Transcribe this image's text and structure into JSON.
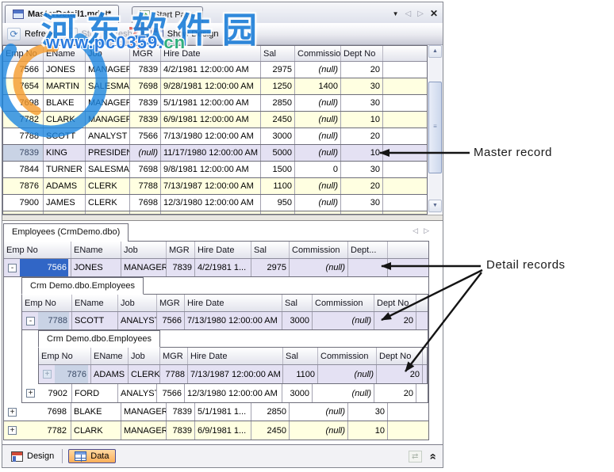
{
  "window": {
    "document_tabs": [
      {
        "label": "MasterDetail1.mdet*",
        "active": true
      },
      {
        "label": "Start Page",
        "active": false
      }
    ],
    "controls": {
      "dropdown": "▼",
      "prev": "◁",
      "next": "▷",
      "close": "✕"
    }
  },
  "toolbar": {
    "refresh": "Refresh",
    "stop_refresh": "Stop Refresh",
    "show_design": "Show Design",
    "refresh_icon": "⟳",
    "stop_icon": "▪"
  },
  "watermark": {
    "site_name": "河东软件园",
    "url_main": "www.pc0359.",
    "url_tld": "cn",
    "accent_char": "东",
    "brand_blue": "#1d7fd9",
    "brand_orange": "#f59b2c",
    "brand_red": "#d63a2a",
    "brand_green": "#2fae7d"
  },
  "colors": {
    "row_alt": "#ffffe1",
    "row_selected": "#e4e1f3",
    "cell_focus": "#3166c6",
    "active_bottom_tab": "#fcae59"
  },
  "master_grid": {
    "columns": [
      "Emp No",
      "EName",
      "Job",
      "MGR",
      "Hire Date",
      "Sal",
      "Commission",
      "Dept No"
    ],
    "rows": [
      {
        "kind": "row",
        "bg": "white",
        "cells": [
          "7566",
          "JONES",
          "MANAGER",
          "7839",
          "4/2/1981 12:00:00 AM",
          "2975",
          "(null)",
          "20"
        ]
      },
      {
        "kind": "row",
        "bg": "cream",
        "cells": [
          "7654",
          "MARTIN",
          "SALESMAN",
          "7698",
          "9/28/1981 12:00:00 AM",
          "1250",
          "1400",
          "30"
        ]
      },
      {
        "kind": "row",
        "bg": "white",
        "cells": [
          "7698",
          "BLAKE",
          "MANAGER",
          "7839",
          "5/1/1981 12:00:00 AM",
          "2850",
          "(null)",
          "30"
        ]
      },
      {
        "kind": "row",
        "bg": "cream",
        "cells": [
          "7782",
          "CLARK",
          "MANAGER",
          "7839",
          "6/9/1981 12:00:00 AM",
          "2450",
          "(null)",
          "10"
        ]
      },
      {
        "kind": "row",
        "bg": "white",
        "cells": [
          "7788",
          "SCOTT",
          "ANALYST",
          "7566",
          "7/13/1980 12:00:00 AM",
          "3000",
          "(null)",
          "20"
        ]
      },
      {
        "kind": "row",
        "bg": "selected",
        "steel_first": true,
        "cells": [
          "7839",
          "KING",
          "PRESIDENT",
          "(null)",
          "11/17/1980 12:00:00 AM",
          "5000",
          "(null)",
          "10"
        ]
      },
      {
        "kind": "row",
        "bg": "white",
        "cells": [
          "7844",
          "TURNER",
          "SALESMAN",
          "7698",
          "9/8/1981 12:00:00 AM",
          "1500",
          "0",
          "30"
        ]
      },
      {
        "kind": "row",
        "bg": "cream",
        "cells": [
          "7876",
          "ADAMS",
          "CLERK",
          "7788",
          "7/13/1987 12:00:00 AM",
          "1100",
          "(null)",
          "20"
        ]
      },
      {
        "kind": "row",
        "bg": "white",
        "cells": [
          "7900",
          "JAMES",
          "CLERK",
          "7698",
          "12/3/1980 12:00:00 AM",
          "950",
          "(null)",
          "30"
        ]
      }
    ]
  },
  "detail_panel": {
    "tab_label": "Employees (CrmDemo.dbo)",
    "nav": {
      "prev": "◁",
      "next": "▷"
    },
    "grid": {
      "headers": [
        "Emp No",
        "EName",
        "Job",
        "MGR",
        "Hire Date",
        "Sal",
        "Commission",
        "Dept..."
      ],
      "items": [
        {
          "kind": "row",
          "expander": "-",
          "bg": "selected",
          "focus_first": true,
          "cells": [
            "7566",
            "JONES",
            "MANAGER",
            "7839",
            "4/2/1981 1...",
            "2975",
            "(null)",
            ""
          ]
        },
        {
          "kind": "subgrid",
          "tab_label": "Crm Demo.dbo.Employees",
          "headers": [
            "Emp No",
            "EName",
            "Job",
            "MGR",
            "Hire Date",
            "Sal",
            "Commission",
            "Dept No"
          ],
          "items": [
            {
              "kind": "row",
              "expander": "-",
              "bg": "selected",
              "steel_first": true,
              "cells": [
                "7788",
                "SCOTT",
                "ANALYST",
                "7566",
                "7/13/1980 12:00:00 AM",
                "3000",
                "(null)",
                "20"
              ]
            },
            {
              "kind": "subgrid",
              "tab_label": "Crm Demo.dbo.Employees",
              "headers": [
                "Emp No",
                "EName",
                "Job",
                "MGR",
                "Hire Date",
                "Sal",
                "Commission",
                "Dept No"
              ],
              "items": [
                {
                  "kind": "row",
                  "expander": "+",
                  "bg": "selected",
                  "steel_first": true,
                  "faded_expander": true,
                  "cells": [
                    "7876",
                    "ADAMS",
                    "CLERK",
                    "7788",
                    "7/13/1987 12:00:00 AM",
                    "1100",
                    "(null)",
                    "20"
                  ]
                }
              ]
            },
            {
              "kind": "row",
              "expander": "+",
              "bg": "white",
              "cells": [
                "7902",
                "FORD",
                "ANALYST",
                "7566",
                "12/3/1980 12:00:00 AM",
                "3000",
                "(null)",
                "20"
              ]
            }
          ]
        },
        {
          "kind": "row",
          "expander": "+",
          "bg": "white",
          "cells": [
            "7698",
            "BLAKE",
            "MANAGER",
            "7839",
            "5/1/1981 1...",
            "2850",
            "(null)",
            "30"
          ]
        },
        {
          "kind": "row",
          "expander": "+",
          "bg": "cream",
          "cells": [
            "7782",
            "CLARK",
            "MANAGER",
            "7839",
            "6/9/1981 1...",
            "2450",
            "(null)",
            "10"
          ]
        }
      ]
    }
  },
  "annotations": {
    "master": "Master record",
    "details": "Detail records"
  },
  "bottom_bar": {
    "design": "Design",
    "data": "Data",
    "collapse_chevron": "»",
    "sync_icon": "⇄"
  },
  "scrollbar": {
    "up": "▲",
    "down": "▼",
    "grip": "≡"
  }
}
